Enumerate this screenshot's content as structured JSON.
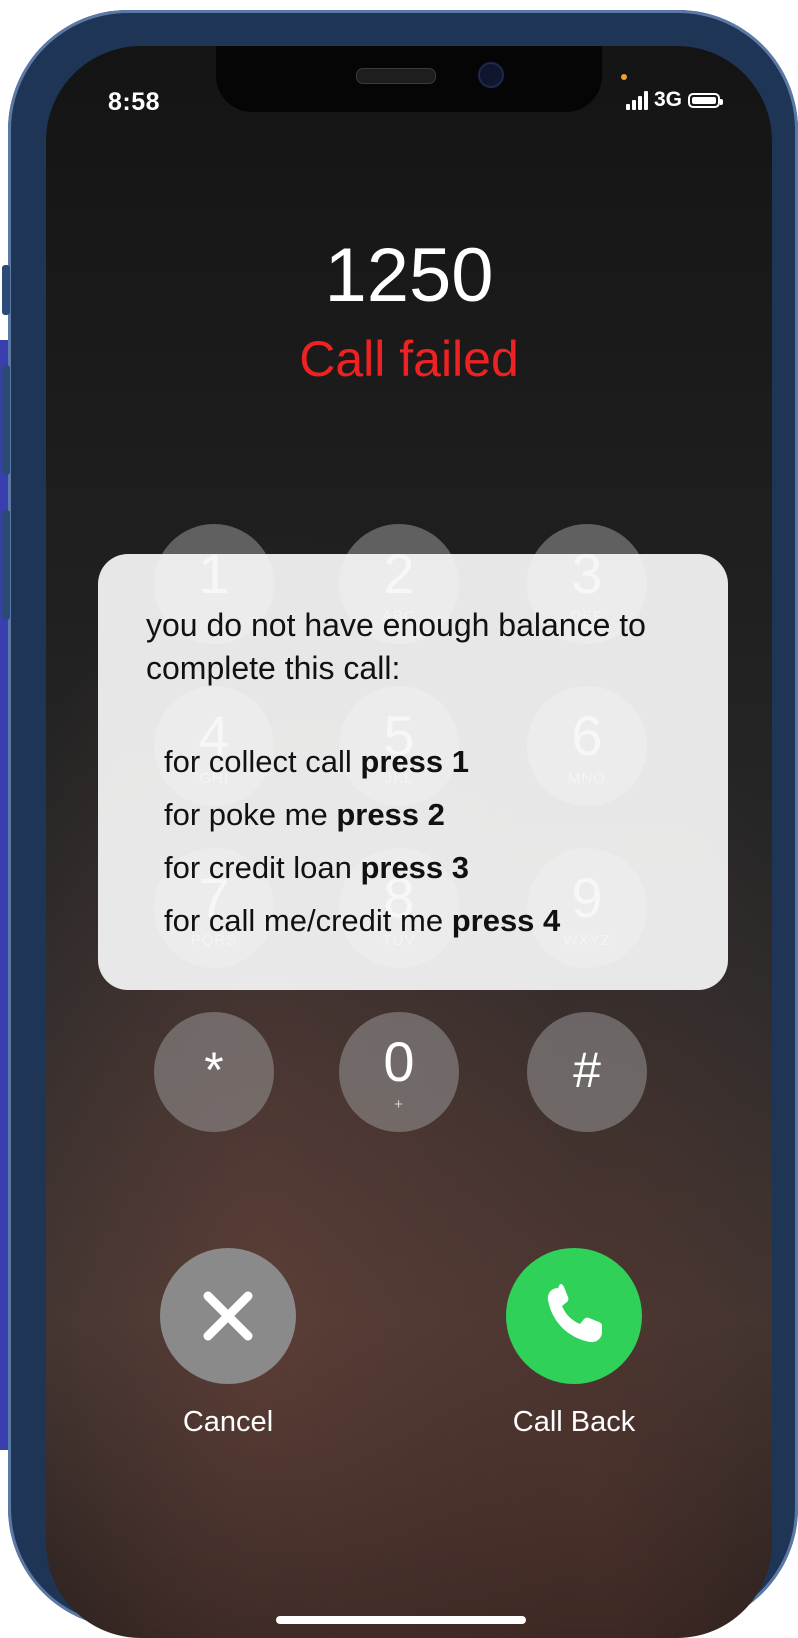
{
  "status_bar": {
    "time": "8:58",
    "network": "3G"
  },
  "call": {
    "number": "1250",
    "status": "Call failed"
  },
  "keypad": [
    {
      "digit": "1",
      "letters": ""
    },
    {
      "digit": "2",
      "letters": "ABC"
    },
    {
      "digit": "3",
      "letters": "DEF"
    },
    {
      "digit": "4",
      "letters": "GHI"
    },
    {
      "digit": "5",
      "letters": "JKL"
    },
    {
      "digit": "6",
      "letters": "MNO"
    },
    {
      "digit": "7",
      "letters": "PQRS"
    },
    {
      "digit": "8",
      "letters": "TUV"
    },
    {
      "digit": "9",
      "letters": "WXYZ"
    },
    {
      "digit": "*",
      "letters": ""
    },
    {
      "digit": "0",
      "letters": "+"
    },
    {
      "digit": "#",
      "letters": ""
    }
  ],
  "popup": {
    "intro": "you do not have enough balance to complete this call:",
    "options": [
      {
        "text": "for collect call ",
        "action": "press 1"
      },
      {
        "text": "for poke me ",
        "action": "press 2"
      },
      {
        "text": "for credit loan ",
        "action": "press 3"
      },
      {
        "text": "for call me/credit me ",
        "action": "press 4"
      }
    ]
  },
  "actions": {
    "cancel_label": "Cancel",
    "call_back_label": "Call Back"
  },
  "colors": {
    "call_failed": "#ee2222",
    "call_back": "#30d158",
    "cancel": "#8a8a8a"
  }
}
